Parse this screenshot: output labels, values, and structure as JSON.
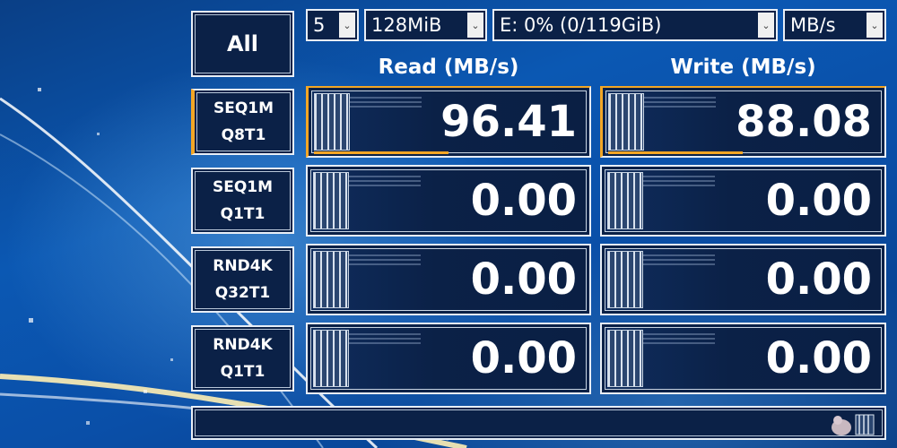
{
  "controls": {
    "all_label": "All",
    "count": "5",
    "size": "128MiB",
    "drive": "E: 0% (0/119GiB)",
    "unit": "MB/s"
  },
  "columns": {
    "read": "Read (MB/s)",
    "write": "Write (MB/s)"
  },
  "tests": [
    {
      "line1": "SEQ1M",
      "line2": "Q8T1",
      "read": "96.41",
      "write": "88.08",
      "active": true
    },
    {
      "line1": "SEQ1M",
      "line2": "Q1T1",
      "read": "0.00",
      "write": "0.00",
      "active": false
    },
    {
      "line1": "RND4K",
      "line2": "Q32T1",
      "read": "0.00",
      "write": "0.00",
      "active": false
    },
    {
      "line1": "RND4K",
      "line2": "Q1T1",
      "read": "0.00",
      "write": "0.00",
      "active": false
    }
  ],
  "colors": {
    "accent": "#f3a625",
    "panel": "#0b2147",
    "border": "#e8eef6"
  },
  "status": {
    "text": ""
  }
}
